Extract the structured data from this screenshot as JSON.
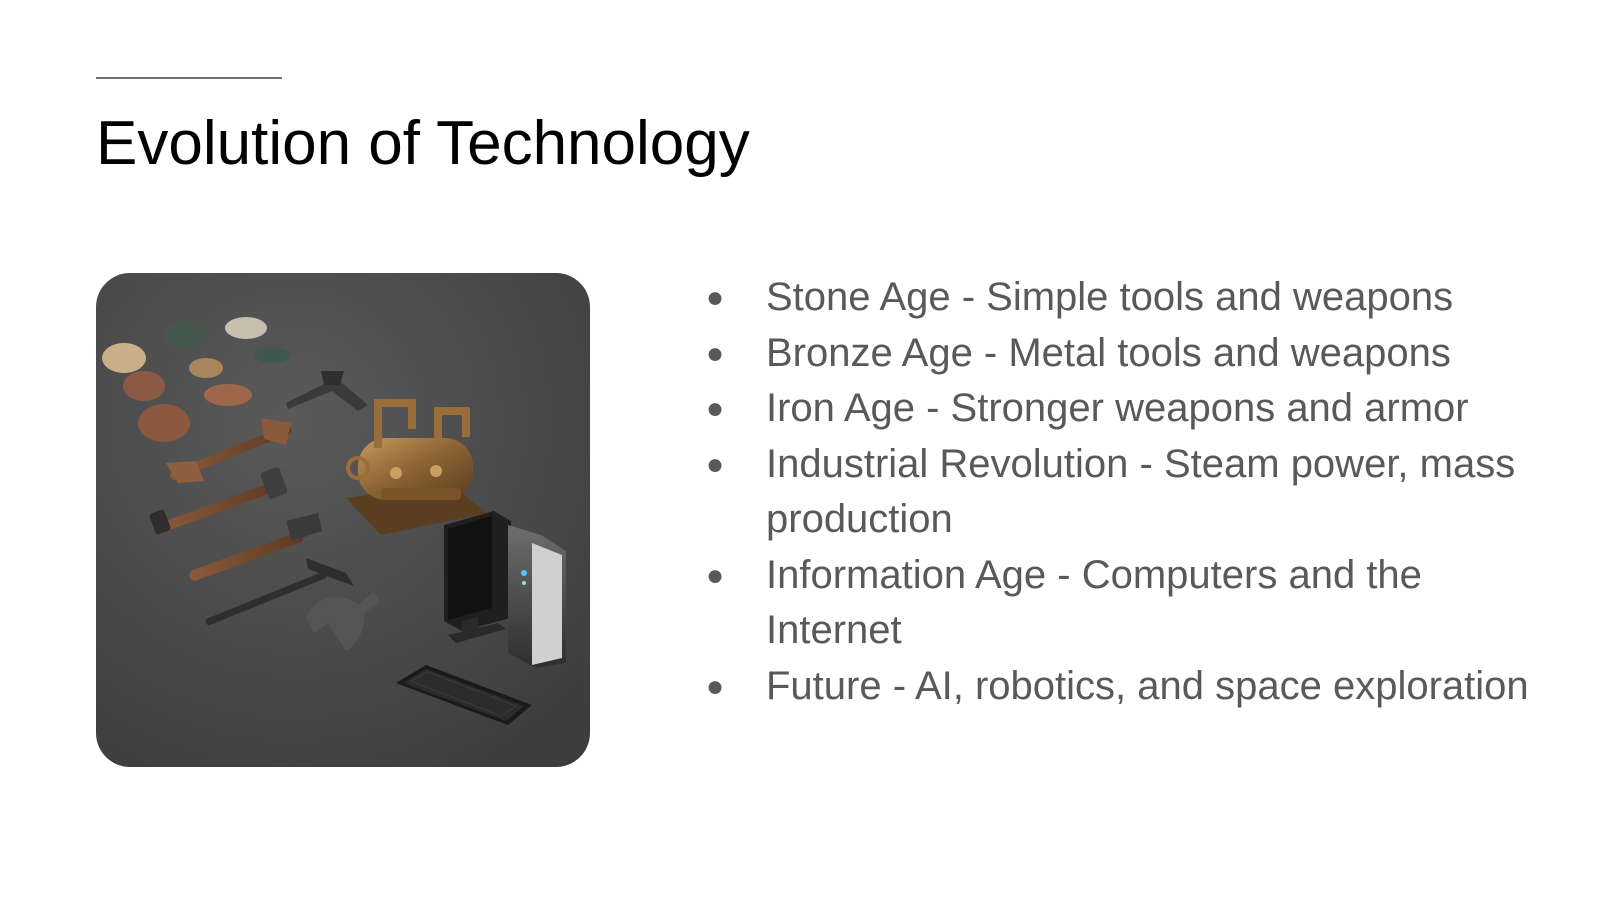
{
  "slide": {
    "title": "Evolution of Technology",
    "image": {
      "icon": "technology-evolution-illustration",
      "depicts": [
        "rocks",
        "stone-tools",
        "steam-engine",
        "desktop-computer",
        "keyboard"
      ]
    },
    "bullet_symbol": "●",
    "bullets": [
      {
        "text": "Stone Age - Simple tools and weapons"
      },
      {
        "text": "Bronze Age - Metal tools and weapons"
      },
      {
        "text": "Iron Age - Stronger weapons and armor"
      },
      {
        "text": "Industrial Revolution - Steam power, mass production"
      },
      {
        "text": "Information Age - Computers and the Internet"
      },
      {
        "text": "Future - AI, robotics, and space exploration"
      }
    ]
  },
  "colors": {
    "title": "#000000",
    "body_text": "#595959",
    "accent_line": "#6f6f6f",
    "image_background": "#4a4a4a"
  }
}
